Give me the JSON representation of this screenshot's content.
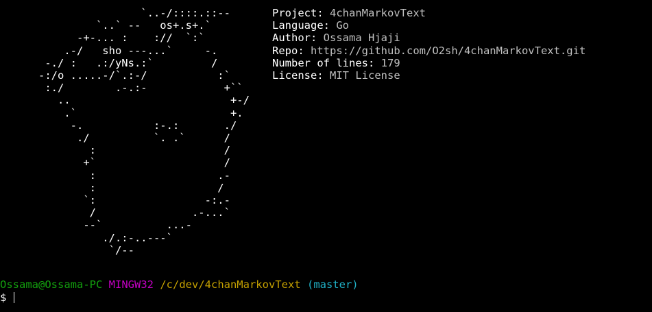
{
  "ascii_art": [
    "                      `..-/::::.::--",
    "               `..` --   os+.s+.`",
    "            -+-... :    ://  `:`",
    "          .-/   sho ---...`     -.",
    "       -./ :   .:/yNs.:`         /",
    "      -:/o .....-/`.:-/           :`",
    "       :./        .-.:-            +``",
    "         ..                         +-/",
    "          .`                        +.",
    "           -.           :-.:       ./",
    "            ./          `. .`      /",
    "              :                    /",
    "             +`                    /",
    "              :                   .-",
    "              :                   /",
    "             `:                 -:.-",
    "              /               .-...`",
    "             --`          ...-",
    "                ./.:-..---`",
    "                 `/--"
  ],
  "info": [
    {
      "key": "Project:",
      "value": "4chanMarkovText"
    },
    {
      "key": "Language:",
      "value": "Go"
    },
    {
      "key": "Author:",
      "value": "Ossama Hjaji"
    },
    {
      "key": "Repo:",
      "value": "https://github.com/O2sh/4chanMarkovText.git"
    },
    {
      "key": "Number of lines:",
      "value": "179"
    },
    {
      "key": "License:",
      "value": "MIT License"
    }
  ],
  "prompt": {
    "user_host": "Ossama@Ossama-PC",
    "system": "MINGW32",
    "path": "/c/dev/4chanMarkovText",
    "branch": "(master)",
    "symbol": "$"
  },
  "colors": {
    "background": "#000000",
    "text": "#ffffff",
    "value_text": "#c0c0c0",
    "user_host": "#13a10e",
    "system": "#c300c3",
    "path": "#c4a000",
    "branch": "#20b2c8"
  }
}
